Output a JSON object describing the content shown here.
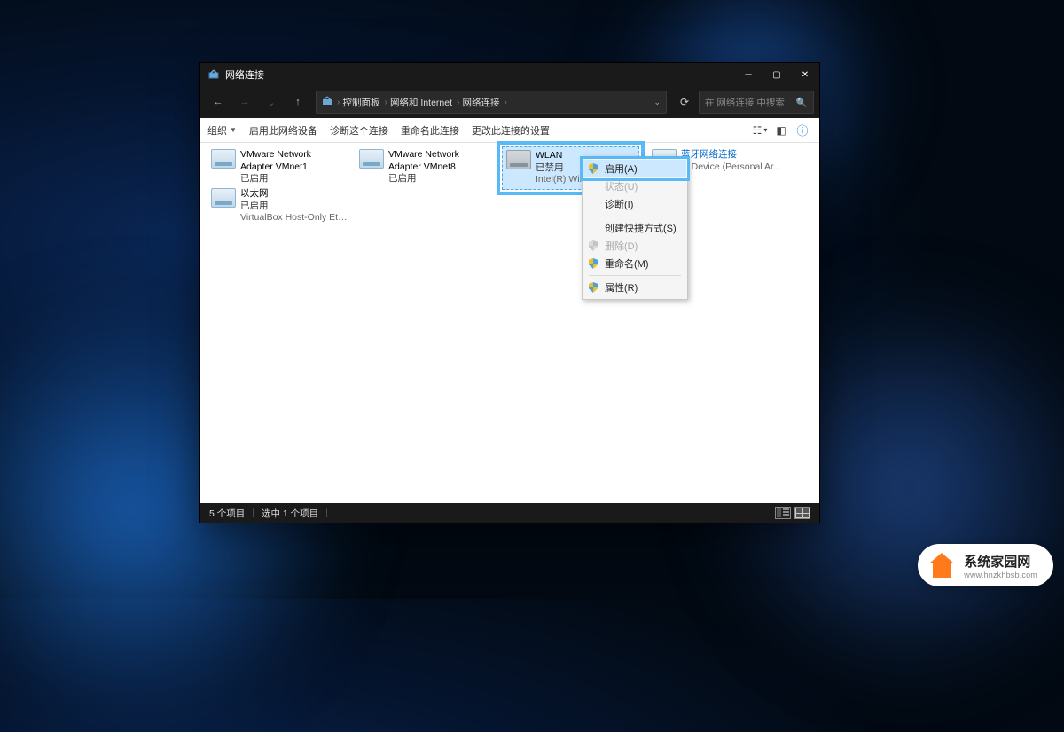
{
  "window": {
    "title": "网络连接"
  },
  "breadcrumb": [
    "控制面板",
    "网络和 Internet",
    "网络连接"
  ],
  "search": {
    "placeholder": "在 网络连接 中搜索"
  },
  "toolbar": {
    "organize": "组织",
    "enable_device": "启用此网络设备",
    "diagnose": "诊断这个连接",
    "rename": "重命名此连接",
    "change_settings": "更改此连接的设置"
  },
  "adapters": [
    {
      "name": "VMware Network Adapter VMnet1",
      "status": "已启用",
      "desc": ""
    },
    {
      "name": "VMware Network Adapter VMnet8",
      "status": "已启用",
      "desc": ""
    },
    {
      "name": "WLAN",
      "status": "已禁用",
      "desc": "Intel(R) Wireless-..."
    },
    {
      "name": "蓝牙网络连接",
      "status": "",
      "desc": "th Device (Personal Ar..."
    },
    {
      "name": "以太网",
      "status": "已启用",
      "desc": "VirtualBox Host-Only Ethernet ..."
    }
  ],
  "context_menu": {
    "enable": "启用(A)",
    "status_item": "状态(U)",
    "diagnose": "诊断(I)",
    "shortcut": "创建快捷方式(S)",
    "delete": "删除(D)",
    "rename": "重命名(M)",
    "properties": "属性(R)"
  },
  "statusbar": {
    "items_count": "5 个项目",
    "selection": "选中 1 个项目"
  },
  "watermark": {
    "title": "系统家园网",
    "url": "www.hnzkhbsb.com"
  }
}
